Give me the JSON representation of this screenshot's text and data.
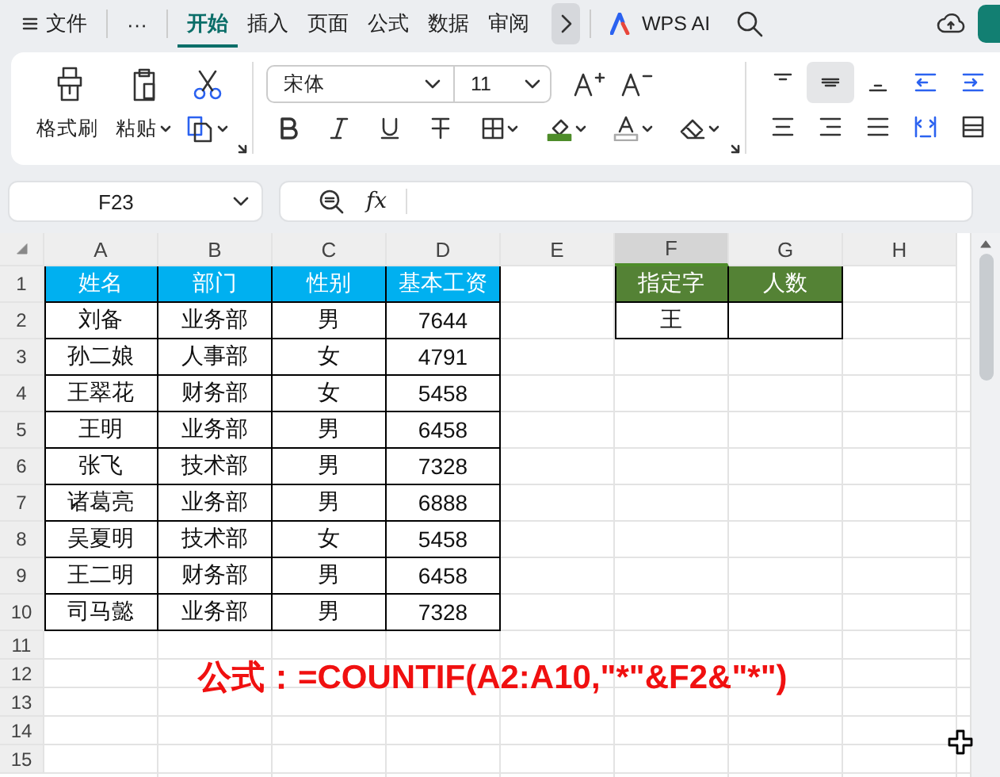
{
  "menu_tabs": [
    {
      "label": "文件",
      "selected": false
    },
    {
      "label": "···",
      "selected": false
    },
    {
      "label": "开始",
      "selected": true
    },
    {
      "label": "插入",
      "selected": false
    },
    {
      "label": "页面",
      "selected": false
    },
    {
      "label": "公式",
      "selected": false
    },
    {
      "label": "数据",
      "selected": false
    },
    {
      "label": "审阅",
      "selected": false
    }
  ],
  "ai_button": "WPS AI",
  "ribbon": {
    "format_painter": "格式刷",
    "paste": "粘贴",
    "font_name": "宋体",
    "font_size": "11"
  },
  "name_box": "F23",
  "formula_bar": {
    "fx": "fx"
  },
  "columns": [
    {
      "label": "A",
      "selected": false
    },
    {
      "label": "B",
      "selected": false
    },
    {
      "label": "C",
      "selected": false
    },
    {
      "label": "D",
      "selected": false
    },
    {
      "label": "E",
      "selected": false
    },
    {
      "label": "F",
      "selected": true
    },
    {
      "label": "G",
      "selected": false
    },
    {
      "label": "H",
      "selected": false
    }
  ],
  "row_numbers": [
    "1",
    "2",
    "3",
    "4",
    "5",
    "6",
    "7",
    "8",
    "9",
    "10",
    "11",
    "12",
    "13",
    "14",
    "15"
  ],
  "tables": [
    {
      "color": "#00b0f0",
      "columns": [
        "姓名",
        "部门",
        "性别",
        "基本工资"
      ],
      "rows": [
        [
          "刘备",
          "业务部",
          "男",
          "7644"
        ],
        [
          "孙二娘",
          "人事部",
          "女",
          "4791"
        ],
        [
          "王翠花",
          "财务部",
          "女",
          "5458"
        ],
        [
          "王明",
          "业务部",
          "男",
          "6458"
        ],
        [
          "张飞",
          "技术部",
          "男",
          "7328"
        ],
        [
          "诸葛亮",
          "业务部",
          "男",
          "6888"
        ],
        [
          "吴夏明",
          "技术部",
          "女",
          "5458"
        ],
        [
          "王二明",
          "财务部",
          "男",
          "6458"
        ],
        [
          "司马懿",
          "业务部",
          "男",
          "7328"
        ]
      ]
    },
    {
      "color": "#548235",
      "columns": [
        "指定字",
        "人数"
      ],
      "rows": [
        [
          "王"
        ]
      ]
    }
  ],
  "formula_note": "公式：=COUNTIF(A2:A10,\"*\"&F2&\"*\")"
}
